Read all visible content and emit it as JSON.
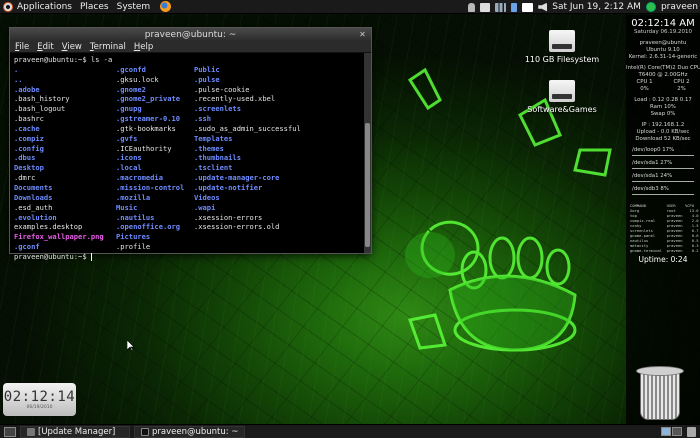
{
  "top_panel": {
    "menus": [
      "Applications",
      "Places",
      "System"
    ],
    "clock": "Sat Jun 19,  2:12 AM",
    "user": "praveen"
  },
  "terminal": {
    "title": "praveen@ubuntu: ~",
    "menu": [
      "File",
      "Edit",
      "View",
      "Terminal",
      "Help"
    ],
    "command_line": "praveen@ubuntu:~$ ls -a",
    "prompt_line": "praveen@ubuntu:~$ ",
    "ls_columns": [
      [
        {
          "name": ".",
          "type": "dir"
        },
        {
          "name": "..",
          "type": "dir"
        },
        {
          "name": ".adobe",
          "type": "dir"
        },
        {
          "name": ".bash_history",
          "type": "file"
        },
        {
          "name": ".bash_logout",
          "type": "file"
        },
        {
          "name": ".bashrc",
          "type": "file"
        },
        {
          "name": ".cache",
          "type": "dir"
        },
        {
          "name": ".compiz",
          "type": "dir"
        },
        {
          "name": ".config",
          "type": "dir"
        },
        {
          "name": ".dbus",
          "type": "dir"
        },
        {
          "name": "Desktop",
          "type": "dir"
        },
        {
          "name": ".dmrc",
          "type": "file"
        },
        {
          "name": "Documents",
          "type": "dir"
        },
        {
          "name": "Downloads",
          "type": "dir"
        },
        {
          "name": ".esd_auth",
          "type": "file"
        },
        {
          "name": ".evolution",
          "type": "dir"
        },
        {
          "name": "examples.desktop",
          "type": "file"
        },
        {
          "name": "Firefox_wallpaper.png",
          "type": "img"
        },
        {
          "name": ".gconf",
          "type": "dir"
        }
      ],
      [
        {
          "name": ".gconfd",
          "type": "dir"
        },
        {
          "name": ".gksu.lock",
          "type": "file"
        },
        {
          "name": ".gnome2",
          "type": "dir"
        },
        {
          "name": ".gnome2_private",
          "type": "dir"
        },
        {
          "name": ".gnupg",
          "type": "dir"
        },
        {
          "name": ".gstreamer-0.10",
          "type": "dir"
        },
        {
          "name": ".gtk-bookmarks",
          "type": "file"
        },
        {
          "name": ".gvfs",
          "type": "dir"
        },
        {
          "name": ".ICEauthority",
          "type": "file"
        },
        {
          "name": ".icons",
          "type": "dir"
        },
        {
          "name": ".local",
          "type": "dir"
        },
        {
          "name": ".macromedia",
          "type": "dir"
        },
        {
          "name": ".mission-control",
          "type": "dir"
        },
        {
          "name": ".mozilla",
          "type": "dir"
        },
        {
          "name": "Music",
          "type": "dir"
        },
        {
          "name": ".nautilus",
          "type": "dir"
        },
        {
          "name": ".openoffice.org",
          "type": "dir"
        },
        {
          "name": "Pictures",
          "type": "dir"
        },
        {
          "name": ".profile",
          "type": "file"
        }
      ],
      [
        {
          "name": "Public",
          "type": "dir"
        },
        {
          "name": ".pulse",
          "type": "dir"
        },
        {
          "name": ".pulse-cookie",
          "type": "file"
        },
        {
          "name": ".recently-used.xbel",
          "type": "file"
        },
        {
          "name": ".screenlets",
          "type": "dir"
        },
        {
          "name": ".ssh",
          "type": "dir"
        },
        {
          "name": ".sudo_as_admin_successful",
          "type": "file"
        },
        {
          "name": "Templates",
          "type": "dir"
        },
        {
          "name": ".themes",
          "type": "dir"
        },
        {
          "name": ".thumbnails",
          "type": "dir"
        },
        {
          "name": ".tsclient",
          "type": "dir"
        },
        {
          "name": ".update-manager-core",
          "type": "dir"
        },
        {
          "name": ".update-notifier",
          "type": "dir"
        },
        {
          "name": "Videos",
          "type": "dir"
        },
        {
          "name": ".wapi",
          "type": "dir"
        },
        {
          "name": ".xsession-errors",
          "type": "file"
        },
        {
          "name": ".xsession-errors.old",
          "type": "file"
        }
      ]
    ]
  },
  "desktop_icons": [
    {
      "label": "110 GB Filesystem"
    },
    {
      "label": "Software&Games"
    }
  ],
  "conky": {
    "time": "02:12:14 AM",
    "date": "Saturday 06.19.2010",
    "user_host": "praveen@ubuntu",
    "os": "Ubuntu 9.10",
    "kernel": "Kernel: 2.6.31-14-generic",
    "cpu_model": "Intel(R) Core(TM)2 Duo CPU",
    "cpu_model2": "T6400  @ 2.00GHz",
    "cpu1_label": "CPU 1",
    "cpu2_label": "CPU 2",
    "cpu1_value": "0%",
    "cpu2_value": "2%",
    "load": "Load : 0.12 0.28 0.17",
    "ram": "Ram 10%",
    "swap": "Swap 0%",
    "ip": "IP : 192.168.1.2",
    "upload": "Upload  -  0.0 KB/sec",
    "download": "Download   52  KB/sec",
    "disks": [
      {
        "label": "/dev/loop0",
        "value": "17%"
      },
      {
        "label": "/dev/sda1",
        "value": "27%"
      },
      {
        "label": "/dev/sda1",
        "value": "24%"
      },
      {
        "label": "/dev/sdb3",
        "value": "8%"
      }
    ],
    "proc_header": "COMMAND         USER    %CPU",
    "proc_rows": [
      "Xorg            root      13.6",
      "top             praveen    4.0",
      "compiz.real     praveen    2.0",
      "conky           praveen    1.5",
      "screenlets      praveen    0.7",
      "gnome-panel     praveen    0.6",
      "nautilus        praveen    0.5",
      "metacity        praveen    0.3",
      "gnome-terminal  praveen    0.2"
    ],
    "uptime": "Uptime: 0:24"
  },
  "clock_widget": {
    "time": "02:12:14",
    "date": "06/19/2010"
  },
  "bottom_panel": {
    "tasks": [
      "[Update Manager]",
      "praveen@ubuntu: ~"
    ]
  },
  "colors": {
    "terminal_dir": "#6f8cff",
    "terminal_image": "#e85ee8",
    "panel": "#1a1a1a"
  }
}
